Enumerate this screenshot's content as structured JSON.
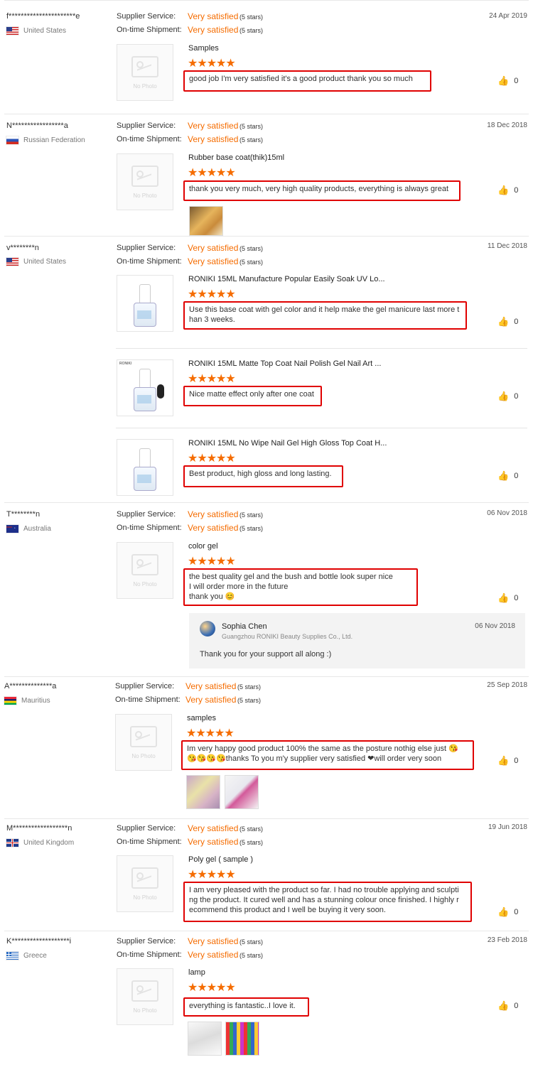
{
  "labels": {
    "supplier": "Supplier Service:",
    "shipment": "On-time Shipment:",
    "no_photo": "No Photo"
  },
  "colors": {
    "accent": "#f56c00",
    "highlight": "#e00000"
  },
  "reviews": [
    {
      "user": "f**********************e",
      "country": "United States",
      "flag": "us",
      "date": "24 Apr 2019",
      "supplier": "Very satisfied",
      "supplier_stars": "(5 stars)",
      "shipment": "Very satisfied",
      "shipment_stars": "(5 stars)",
      "items": [
        {
          "product": "Samples",
          "stars": "★★★★★",
          "feedback": "good job I'm very satisfied it's a good product thank you so much",
          "helpful": "0"
        }
      ]
    },
    {
      "user": "N*****************a",
      "country": "Russian Federation",
      "flag": "ru",
      "date": "18 Dec 2018",
      "supplier": "Very satisfied",
      "supplier_stars": "(5 stars)",
      "shipment": "Very satisfied",
      "shipment_stars": "(5 stars)",
      "items": [
        {
          "product": "Rubber base coat(thik)15ml",
          "stars": "★★★★★",
          "feedback": "thank you very much, very high quality products, everything is always great",
          "helpful": "0"
        }
      ]
    },
    {
      "user": "v********n",
      "country": "United States",
      "flag": "us",
      "date": "11 Dec 2018",
      "supplier": "Very satisfied",
      "supplier_stars": "(5 stars)",
      "shipment": "Very satisfied",
      "shipment_stars": "(5 stars)",
      "items": [
        {
          "product": "RONIKI 15ML Manufacture Popular Easily Soak UV Lo...",
          "stars": "★★★★★",
          "feedback_line1": "Use this base coat with gel color and it help make the gel manicure last more t",
          "feedback_line2": "han 3 weeks.",
          "helpful": "0"
        },
        {
          "product": "RONIKI 15ML Matte Top Coat Nail Polish Gel Nail Art ...",
          "stars": "★★★★★",
          "feedback": "Nice matte effect only after one coat",
          "helpful": "0",
          "brand": "RONIKI"
        },
        {
          "product": "RONIKI 15ML No Wipe Nail Gel High Gloss Top Coat H...",
          "stars": "★★★★★",
          "feedback": "Best product, high gloss and long lasting.",
          "helpful": "0"
        }
      ]
    },
    {
      "user": "T********n",
      "country": "Australia",
      "flag": "au",
      "date": "06 Nov 2018",
      "supplier": "Very satisfied",
      "supplier_stars": "(5 stars)",
      "shipment": "Very satisfied",
      "shipment_stars": "(5 stars)",
      "items": [
        {
          "product": "color gel",
          "stars": "★★★★★",
          "feedback_line1": "the best quality gel and the bush and bottle look super nice",
          "feedback_line2": "I will order more in the future",
          "feedback_line3": "thank you 😊",
          "helpful": "0"
        }
      ],
      "reply": {
        "name": "Sophia Chen",
        "company": "Guangzhou RONIKI Beauty Supplies Co., Ltd.",
        "date": "06 Nov 2018",
        "text": "Thank you for your support all along :)"
      }
    },
    {
      "user": "A**************a",
      "country": "Mauritius",
      "flag": "mu",
      "date": "25 Sep 2018",
      "supplier": "Very satisfied",
      "supplier_stars": "(5 stars)",
      "shipment": "Very satisfied",
      "shipment_stars": "(5 stars)",
      "items": [
        {
          "product": "samples",
          "stars": "★★★★★",
          "feedback_line1": "Im very happy good product 100% the same as the posture nothig else just 😘",
          "feedback_line2": "😘😘😘😘thanks To you  m'y supplier  very satisfied ❤will order very soon",
          "helpful": "0"
        }
      ]
    },
    {
      "user": "M******************n",
      "country": "United Kingdom",
      "flag": "gb",
      "date": "19 Jun 2018",
      "supplier": "Very satisfied",
      "supplier_stars": "(5 stars)",
      "shipment": "Very satisfied",
      "shipment_stars": "(5 stars)",
      "items": [
        {
          "product": "Poly gel ( sample )",
          "stars": "★★★★★",
          "feedback_line1": "I am very pleased with the product so far. I had no trouble applying and sculpti",
          "feedback_line2": "ng the product. It cured well and has a stunning colour once finished. I highly r",
          "feedback_line3": "ecommend this product and I well be buying it very soon.",
          "helpful": "0"
        }
      ]
    },
    {
      "user": "K*******************i",
      "country": "Greece",
      "flag": "gr",
      "date": "23 Feb 2018",
      "supplier": "Very satisfied",
      "supplier_stars": "(5 stars)",
      "shipment": "Very satisfied",
      "shipment_stars": "(5 stars)",
      "items": [
        {
          "product": "lamp",
          "stars": "★★★★★",
          "feedback": "everything is fantastic..I love it.",
          "helpful": "0"
        }
      ]
    }
  ]
}
